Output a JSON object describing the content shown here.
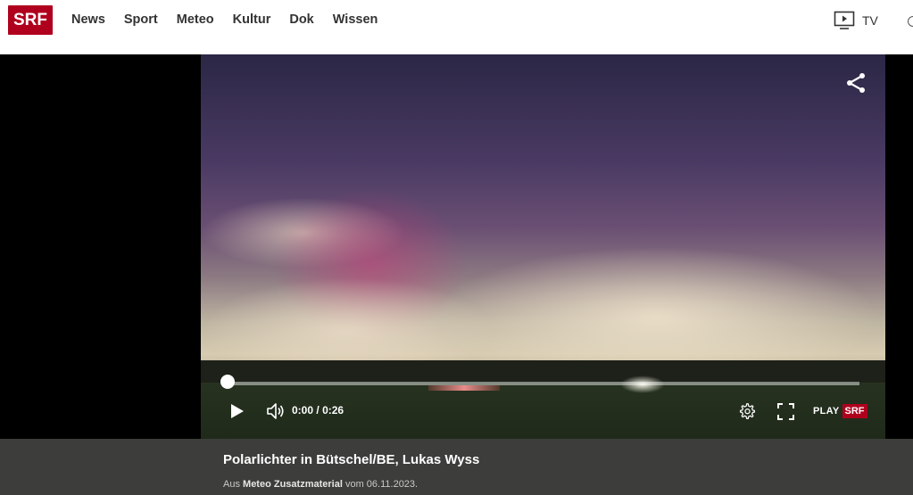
{
  "header": {
    "logo": "SRF",
    "nav": [
      "News",
      "Sport",
      "Meteo",
      "Kultur",
      "Dok",
      "Wissen"
    ],
    "tv_label": "TV"
  },
  "player": {
    "current_time": "0:00",
    "separator": "/",
    "duration": "0:26",
    "progress": 0.0,
    "play_label": "PLAY",
    "play_badge": "SRF"
  },
  "caption": {
    "title": "Polarlichter in Bütschel/BE, Lukas Wyss",
    "meta_prefix": "Aus",
    "meta_source": "Meteo Zusatzmaterial",
    "meta_suffix": "vom 06.11.2023."
  },
  "icons": [
    "share-icon",
    "play-icon",
    "volume-icon",
    "settings-icon",
    "fullscreen-icon",
    "tv-icon",
    "search-icon"
  ],
  "colors": {
    "brand": "#af001d",
    "caption_bg": "#3d3d3b"
  }
}
